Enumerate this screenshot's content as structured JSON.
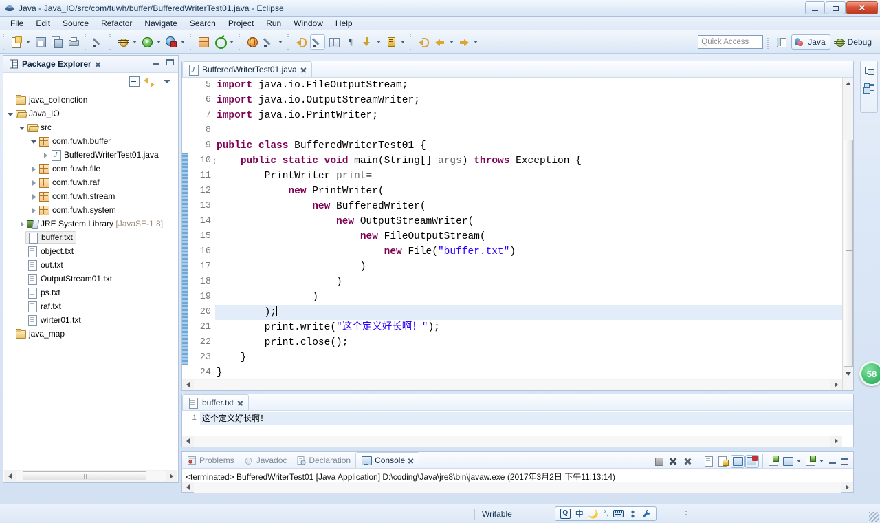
{
  "window": {
    "title": "Java - Java_IO/src/com/fuwh/buffer/BufferedWriterTest01.java - Eclipse",
    "minimize_label": "Minimize",
    "restore_label": "Restore",
    "close_label": "Close"
  },
  "menubar": {
    "items": [
      {
        "label": "File"
      },
      {
        "label": "Edit"
      },
      {
        "label": "Source"
      },
      {
        "label": "Refactor"
      },
      {
        "label": "Navigate"
      },
      {
        "label": "Search"
      },
      {
        "label": "Project"
      },
      {
        "label": "Run"
      },
      {
        "label": "Window"
      },
      {
        "label": "Help"
      }
    ]
  },
  "toolbar": {
    "buttons": [
      {
        "name": "new-wizard",
        "icon": "newdoc"
      },
      {
        "name": "save",
        "icon": "save"
      },
      {
        "name": "save-all",
        "icon": "saveall"
      },
      {
        "name": "print",
        "icon": "print"
      },
      {
        "name": "toggle-mark-occurrences",
        "icon": "pen"
      },
      {
        "name": "debug",
        "icon": "bug"
      },
      {
        "name": "run",
        "icon": "run"
      },
      {
        "name": "run-last-tool",
        "icon": "runlock"
      },
      {
        "name": "new-java-package",
        "icon": "grid"
      },
      {
        "name": "new-java-class",
        "icon": "target"
      },
      {
        "name": "open-type",
        "icon": "glob"
      },
      {
        "name": "search",
        "icon": "pen"
      },
      {
        "name": "next-annotation",
        "icon": "backy"
      },
      {
        "name": "toggle-java-editor",
        "icon": "pen"
      },
      {
        "name": "show-whitespace",
        "icon": "book"
      },
      {
        "name": "pilcrow",
        "icon": "pilcrow"
      },
      {
        "name": "next-edit-location",
        "icon": "down"
      },
      {
        "name": "last-edit-location",
        "icon": "marker"
      },
      {
        "name": "back",
        "icon": "back"
      },
      {
        "name": "forward",
        "icon": "fwd"
      }
    ]
  },
  "quick_access": {
    "placeholder": "Quick Access",
    "value": ""
  },
  "perspectives": {
    "open_perspective_label": "Open Perspective",
    "items": [
      {
        "label": "Java",
        "active": true
      },
      {
        "label": "Debug",
        "active": false
      }
    ]
  },
  "package_explorer": {
    "title": "Package Explorer",
    "close_label": "Close",
    "toolbar": [
      {
        "name": "collapse-all"
      },
      {
        "name": "link-with-editor"
      },
      {
        "name": "view-menu"
      }
    ],
    "tree": [
      {
        "label": "java_collenction",
        "icon": "folder",
        "indent": 1,
        "twisty": "none",
        "selected": false
      },
      {
        "label": "Java_IO",
        "icon": "folderopen",
        "indent": 1,
        "twisty": "open",
        "selected": false
      },
      {
        "label": "src",
        "icon": "pkgroot",
        "indent": 2,
        "twisty": "open",
        "selected": false
      },
      {
        "label": "com.fuwh.buffer",
        "icon": "pkg",
        "indent": 3,
        "twisty": "open",
        "selected": false
      },
      {
        "label": "BufferedWriterTest01.java",
        "icon": "java",
        "indent": 4,
        "twisty": "closed",
        "selected": false
      },
      {
        "label": "com.fuwh.file",
        "icon": "pkg",
        "indent": 3,
        "twisty": "closed",
        "selected": false
      },
      {
        "label": "com.fuwh.raf",
        "icon": "pkg",
        "indent": 3,
        "twisty": "closed",
        "selected": false
      },
      {
        "label": "com.fuwh.stream",
        "icon": "pkg",
        "indent": 3,
        "twisty": "closed",
        "selected": false
      },
      {
        "label": "com.fuwh.system",
        "icon": "pkg",
        "indent": 3,
        "twisty": "closed",
        "selected": false
      },
      {
        "label": "JRE System Library",
        "suffix": "[JavaSE-1.8]",
        "icon": "jre",
        "indent": 2,
        "twisty": "closed",
        "selected": false
      },
      {
        "label": "buffer.txt",
        "icon": "file",
        "indent": 2,
        "twisty": "none",
        "selected": true
      },
      {
        "label": "object.txt",
        "icon": "file",
        "indent": 2,
        "twisty": "none",
        "selected": false
      },
      {
        "label": "out.txt",
        "icon": "file",
        "indent": 2,
        "twisty": "none",
        "selected": false
      },
      {
        "label": "OutputStream01.txt",
        "icon": "file",
        "indent": 2,
        "twisty": "none",
        "selected": false
      },
      {
        "label": "ps.txt",
        "icon": "file",
        "indent": 2,
        "twisty": "none",
        "selected": false
      },
      {
        "label": "raf.txt",
        "icon": "file",
        "indent": 2,
        "twisty": "none",
        "selected": false
      },
      {
        "label": "wirter01.txt",
        "icon": "file",
        "indent": 2,
        "twisty": "none",
        "selected": false
      },
      {
        "label": "java_map",
        "icon": "folder",
        "indent": 1,
        "twisty": "none",
        "selected": false
      }
    ]
  },
  "editor": {
    "tab": {
      "label": "BufferedWriterTest01.java",
      "close_label": "Close"
    },
    "first_line_number": 5,
    "cursor_line": 20,
    "lines": [
      {
        "n": 5,
        "segments": [
          {
            "t": "import",
            "c": "kw"
          },
          {
            "t": " java.io.FileOutputStream;",
            "c": ""
          }
        ]
      },
      {
        "n": 6,
        "segments": [
          {
            "t": "import",
            "c": "kw"
          },
          {
            "t": " java.io.OutputStreamWriter;",
            "c": ""
          }
        ]
      },
      {
        "n": 7,
        "segments": [
          {
            "t": "import",
            "c": "kw"
          },
          {
            "t": " java.io.PrintWriter;",
            "c": ""
          }
        ]
      },
      {
        "n": 8,
        "segments": []
      },
      {
        "n": 9,
        "segments": [
          {
            "t": "public",
            "c": "kw"
          },
          {
            "t": " ",
            "c": ""
          },
          {
            "t": "class",
            "c": "kw"
          },
          {
            "t": " BufferedWriterTest01 {",
            "c": ""
          }
        ]
      },
      {
        "n": 10,
        "segments": [
          {
            "t": "    ",
            "c": ""
          },
          {
            "t": "public",
            "c": "kw"
          },
          {
            "t": " ",
            "c": ""
          },
          {
            "t": "static",
            "c": "kw"
          },
          {
            "t": " ",
            "c": ""
          },
          {
            "t": "void",
            "c": "kw"
          },
          {
            "t": " main(String[] ",
            "c": ""
          },
          {
            "t": "args",
            "c": "param"
          },
          {
            "t": ") ",
            "c": ""
          },
          {
            "t": "throws",
            "c": "kw"
          },
          {
            "t": " Exception {",
            "c": ""
          }
        ]
      },
      {
        "n": 11,
        "segments": [
          {
            "t": "        PrintWriter ",
            "c": ""
          },
          {
            "t": "print",
            "c": "param"
          },
          {
            "t": "=",
            "c": ""
          }
        ]
      },
      {
        "n": 12,
        "segments": [
          {
            "t": "            ",
            "c": ""
          },
          {
            "t": "new",
            "c": "kw"
          },
          {
            "t": " PrintWriter(",
            "c": ""
          }
        ]
      },
      {
        "n": 13,
        "segments": [
          {
            "t": "                ",
            "c": ""
          },
          {
            "t": "new",
            "c": "kw"
          },
          {
            "t": " BufferedWriter(",
            "c": ""
          }
        ]
      },
      {
        "n": 14,
        "segments": [
          {
            "t": "                    ",
            "c": ""
          },
          {
            "t": "new",
            "c": "kw"
          },
          {
            "t": " OutputStreamWriter(",
            "c": ""
          }
        ]
      },
      {
        "n": 15,
        "segments": [
          {
            "t": "                        ",
            "c": ""
          },
          {
            "t": "new",
            "c": "kw"
          },
          {
            "t": " FileOutputStream(",
            "c": ""
          }
        ]
      },
      {
        "n": 16,
        "segments": [
          {
            "t": "                            ",
            "c": ""
          },
          {
            "t": "new",
            "c": "kw"
          },
          {
            "t": " File(",
            "c": ""
          },
          {
            "t": "\"buffer.txt\"",
            "c": "str"
          },
          {
            "t": ")",
            "c": ""
          }
        ]
      },
      {
        "n": 17,
        "segments": [
          {
            "t": "                        )",
            "c": ""
          }
        ]
      },
      {
        "n": 18,
        "segments": [
          {
            "t": "                    )",
            "c": ""
          }
        ]
      },
      {
        "n": 19,
        "segments": [
          {
            "t": "                )",
            "c": ""
          }
        ]
      },
      {
        "n": 20,
        "segments": [
          {
            "t": "        );",
            "c": ""
          }
        ]
      },
      {
        "n": 21,
        "segments": [
          {
            "t": "        print.write(",
            "c": ""
          },
          {
            "t": "\"这个定义好长啊！\"",
            "c": "str"
          },
          {
            "t": ");",
            "c": ""
          }
        ]
      },
      {
        "n": 22,
        "segments": [
          {
            "t": "        print.close();",
            "c": ""
          }
        ]
      },
      {
        "n": 23,
        "segments": [
          {
            "t": "    }",
            "c": ""
          }
        ]
      },
      {
        "n": 24,
        "segments": [
          {
            "t": "}",
            "c": ""
          }
        ]
      }
    ]
  },
  "text_editor": {
    "tab": {
      "label": "buffer.txt",
      "close_label": "Close"
    },
    "lines": [
      {
        "n": 1,
        "text": "这个定义好长啊！"
      }
    ]
  },
  "console_panel": {
    "tabs": [
      {
        "label": "Problems",
        "active": false,
        "icon": "problems-icon"
      },
      {
        "label": "Javadoc",
        "active": false,
        "icon": "javadoc-icon"
      },
      {
        "label": "Declaration",
        "active": false,
        "icon": "declaration-icon"
      },
      {
        "label": "Console",
        "active": true,
        "icon": "console-icon"
      }
    ],
    "close_label": "Close",
    "toolbar": [
      {
        "name": "terminate"
      },
      {
        "name": "remove-launch"
      },
      {
        "name": "remove-all-terminated"
      },
      {
        "name": "scroll-lock"
      },
      {
        "name": "pin-console"
      },
      {
        "name": "display-selected-console"
      },
      {
        "name": "close-console"
      },
      {
        "name": "open-console"
      },
      {
        "name": "new-console-view"
      },
      {
        "name": "minimize"
      },
      {
        "name": "maximize"
      }
    ],
    "output": "<terminated> BufferedWriterTest01 [Java Application] D:\\coding\\Java\\jre8\\bin\\javaw.exe (2017年3月2日 下午11:13:14)"
  },
  "right_stack": {
    "buttons": [
      {
        "name": "restore-view"
      },
      {
        "name": "outline-view"
      }
    ]
  },
  "recorder_badge": {
    "value": "58"
  },
  "statusbar": {
    "writable_label": "Writable",
    "ime": {
      "logo": "Q",
      "mode": "中",
      "items": [
        "moon-icon",
        "punctuation-icon",
        "keyboard-icon",
        "toolbox-icon",
        "wrench-icon"
      ]
    }
  },
  "colors": {
    "keyword": "#7f0055",
    "string": "#2a00ff",
    "line_highlight": "#e3edf9",
    "change_bar": "#6ea8d8",
    "accent": "#2a6aa5"
  }
}
